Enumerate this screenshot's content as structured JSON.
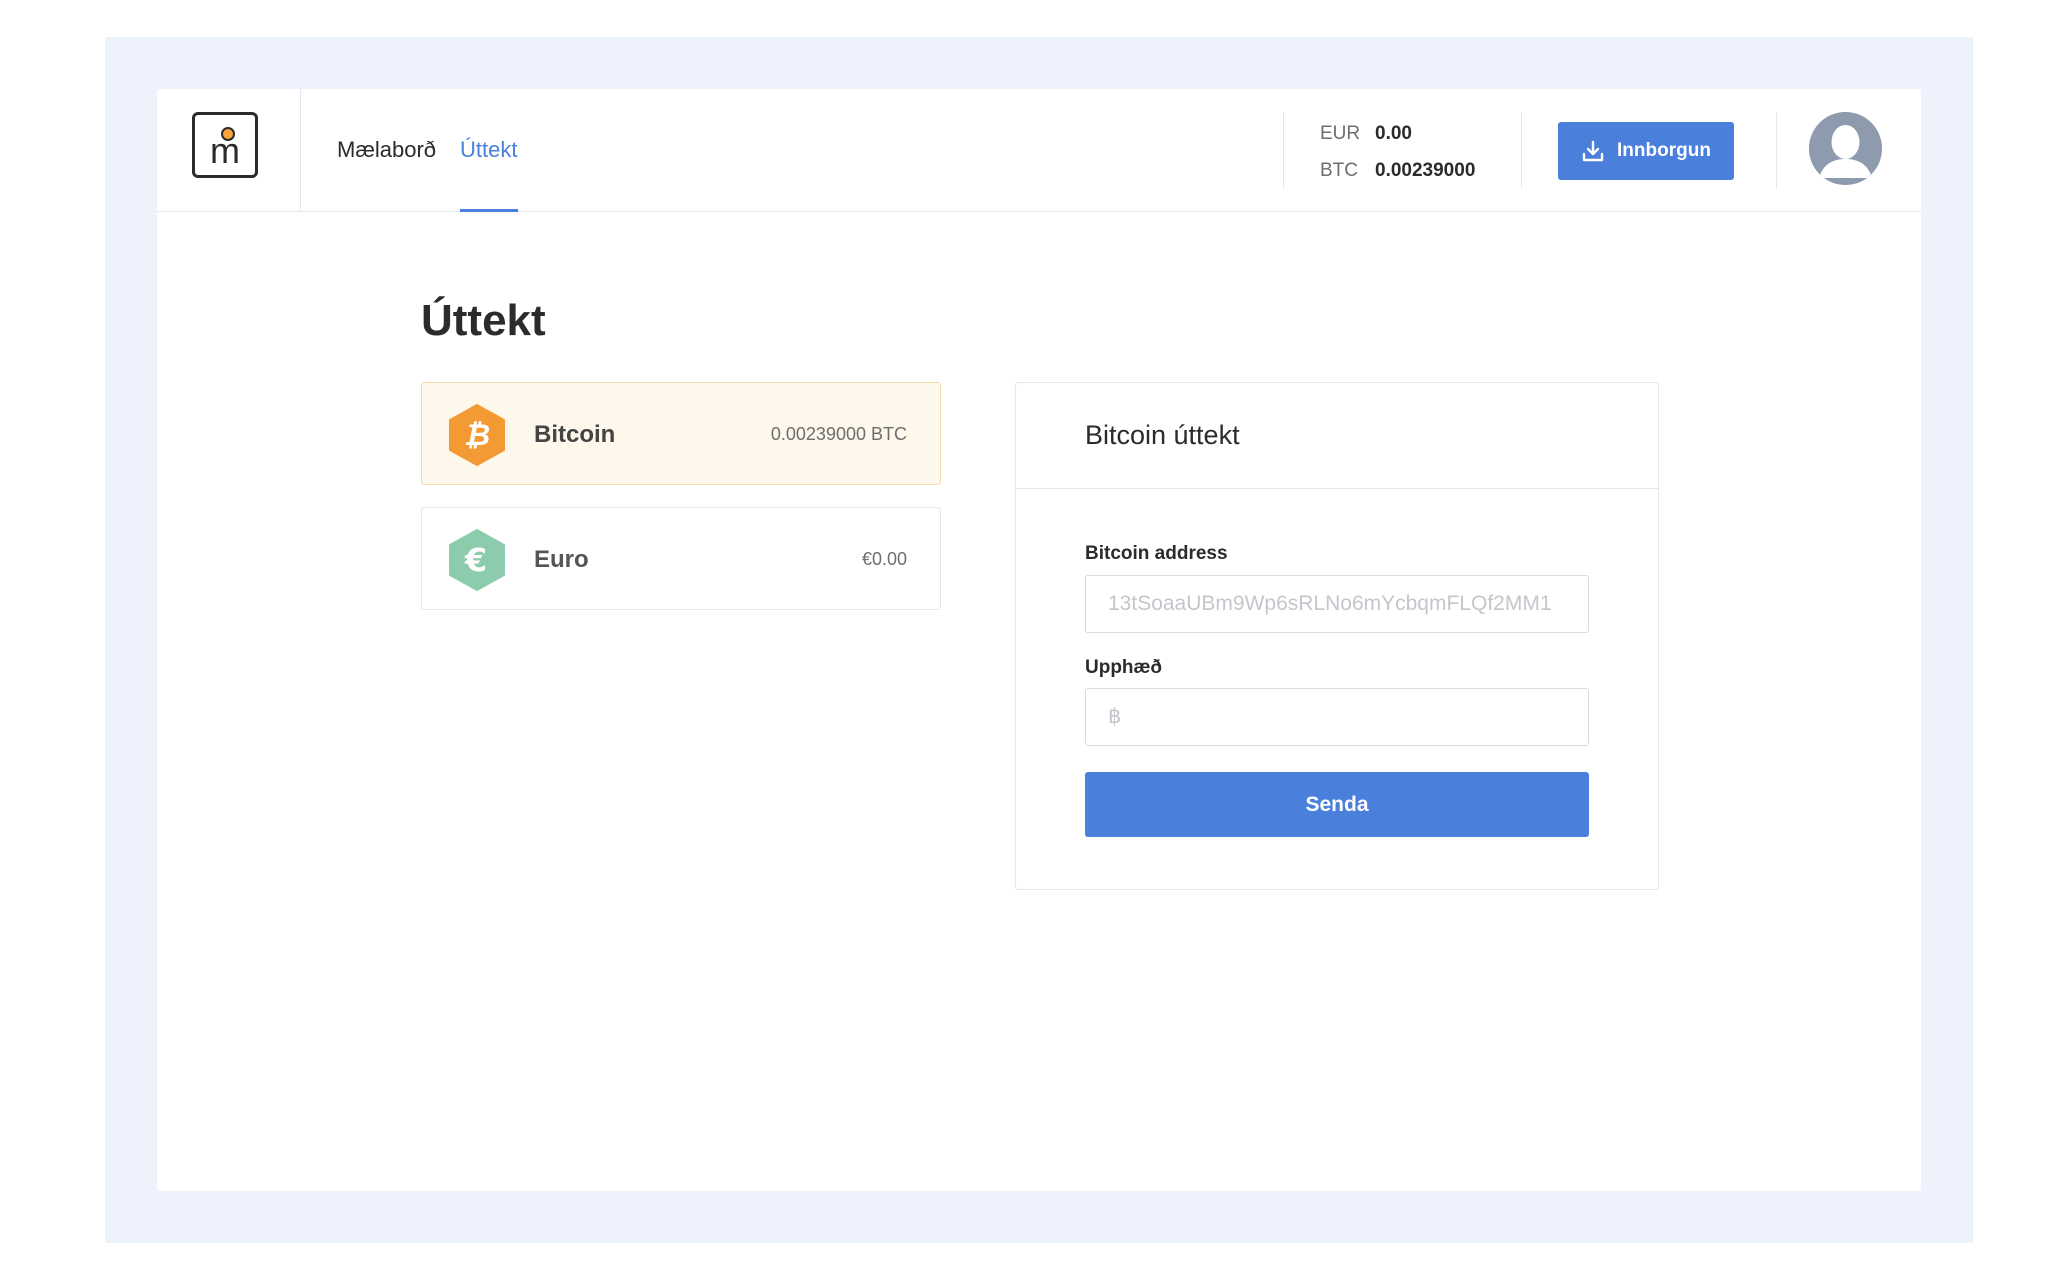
{
  "nav": {
    "items": [
      {
        "label": "Mælaborð",
        "active": false
      },
      {
        "label": "Úttekt",
        "active": true
      }
    ]
  },
  "balances": {
    "eur": {
      "currency": "EUR",
      "value": "0.00"
    },
    "btc": {
      "currency": "BTC",
      "value": "0.00239000"
    }
  },
  "deposit_button": {
    "label": "Innborgun"
  },
  "page": {
    "title": "Úttekt"
  },
  "wallets": [
    {
      "name": "Bitcoin",
      "balance": "0.00239000 BTC",
      "color": "#f39a34",
      "selected": true,
      "icon": "bitcoin-icon"
    },
    {
      "name": "Euro",
      "balance": "€0.00",
      "color": "#8ccbab",
      "selected": false,
      "icon": "euro-icon"
    }
  ],
  "withdraw": {
    "title": "Bitcoin úttekt",
    "address_label": "Bitcoin address",
    "address_placeholder": "13tSoaaUBm9Wp6sRLNo6mYcbqmFLQf2MM1",
    "amount_label": "Upphæð",
    "amount_placeholder": "฿",
    "send_label": "Senda"
  },
  "colors": {
    "accent": "#4a7fdc",
    "frame_bg": "#edf2fc",
    "bitcoin": "#f39a34",
    "euro": "#8ccbab"
  }
}
